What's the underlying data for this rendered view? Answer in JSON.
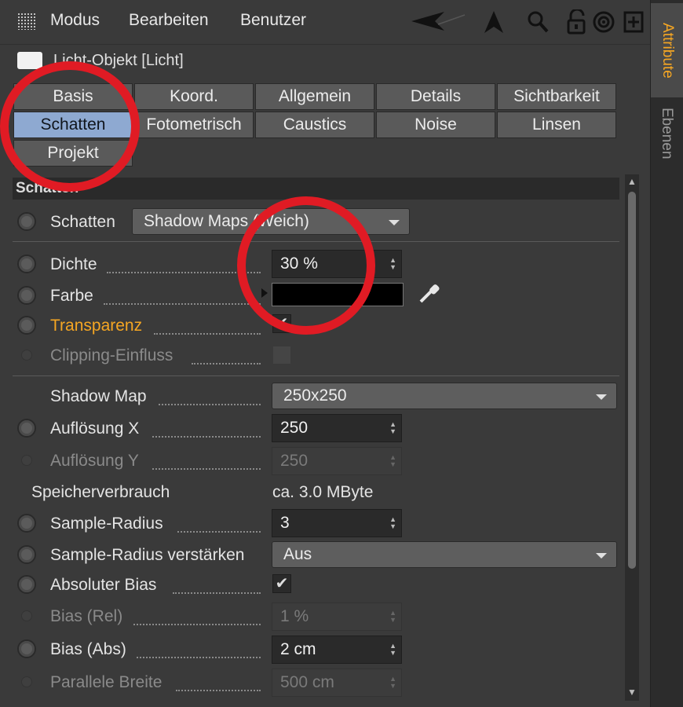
{
  "menu": {
    "items": [
      "Modus",
      "Bearbeiten",
      "Benutzer"
    ]
  },
  "toolbar": {
    "icons": [
      "arrow-back-icon",
      "arrow-up-icon",
      "search-icon",
      "lock-icon",
      "target-icon",
      "add-panel-icon"
    ]
  },
  "right_tabs": {
    "attribute": "Attribute",
    "ebenen": "Ebenen"
  },
  "object": {
    "title": "Licht-Objekt [Licht]"
  },
  "tabs": [
    "Basis",
    "Koord.",
    "Allgemein",
    "Details",
    "Sichtbarkeit",
    "Schatten",
    "Fotometrisch",
    "Caustics",
    "Noise",
    "Linsen",
    "Projekt"
  ],
  "active_tab": "Schatten",
  "section": {
    "title": "Schatten"
  },
  "shadow": {
    "label": "Schatten",
    "value": "Shadow Maps (Weich)"
  },
  "rows": {
    "dichte": {
      "label": "Dichte",
      "value": "30 %"
    },
    "farbe": {
      "label": "Farbe",
      "color": "#000000"
    },
    "transparenz": {
      "label": "Transparenz",
      "checked": true
    },
    "clipping": {
      "label": "Clipping-Einfluss",
      "checked": false
    },
    "shadow_map": {
      "label": "Shadow Map",
      "value": "250x250"
    },
    "aufloesung_x": {
      "label": "Auflösung X",
      "value": "250"
    },
    "aufloesung_y": {
      "label": "Auflösung Y",
      "value": "250"
    },
    "speicher": {
      "label": "Speicherverbrauch",
      "value": "ca. 3.0 MByte"
    },
    "sample_radius": {
      "label": "Sample-Radius",
      "value": "3"
    },
    "sample_verstaerken": {
      "label": "Sample-Radius verstärken",
      "value": "Aus"
    },
    "absoluter_bias": {
      "label": "Absoluter Bias",
      "checked": true
    },
    "bias_rel": {
      "label": "Bias (Rel)",
      "value": "1 %"
    },
    "bias_abs": {
      "label": "Bias (Abs)",
      "value": "2 cm"
    },
    "parallele_breite": {
      "label": "Parallele Breite",
      "value": "500 cm"
    }
  },
  "check_glyph": "✔",
  "colors": {
    "accent": "#f5a623",
    "active_tab": "#8ea9d1",
    "annotation": "#e01b24"
  }
}
